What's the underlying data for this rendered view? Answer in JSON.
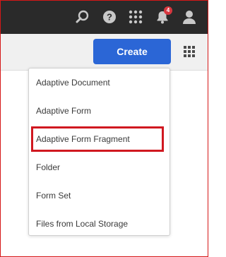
{
  "topbar": {
    "icons": [
      "search-icon",
      "help-icon",
      "apps-grid-icon",
      "bell-icon",
      "user-icon"
    ],
    "notification_count": "4"
  },
  "actionbar": {
    "create_label": "Create",
    "view_icon": "view-switcher-icon"
  },
  "menu": {
    "items": [
      {
        "label": "Adaptive Document"
      },
      {
        "label": "Adaptive Form"
      },
      {
        "label": "Adaptive Form Fragment"
      },
      {
        "label": "Folder"
      },
      {
        "label": "Form Set"
      },
      {
        "label": "Files from Local Storage"
      }
    ]
  },
  "colors": {
    "topbar_bg": "#2a2a2a",
    "create_button": "#2b66d6",
    "highlight_outline": "#d01820",
    "badge": "#d7373f"
  }
}
